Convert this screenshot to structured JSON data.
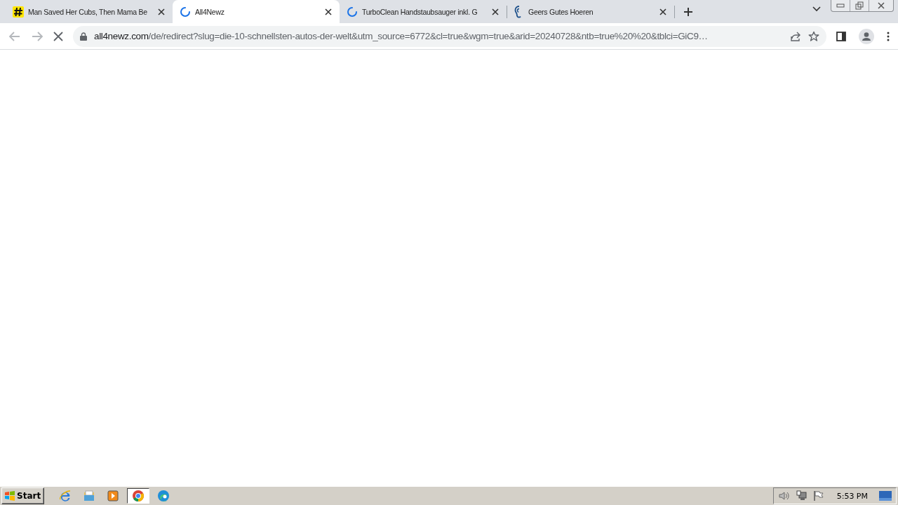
{
  "tabs": [
    {
      "title": "Man Saved Her Cubs, Then Mama Be",
      "kind": "hash",
      "selected": false
    },
    {
      "title": "All4Newz",
      "kind": "loading",
      "selected": true
    },
    {
      "title": "TurboClean Handstaubsauger inkl. G",
      "kind": "loading",
      "selected": false
    },
    {
      "title": "Geers Gutes Hoeren",
      "kind": "ear",
      "selected": false
    }
  ],
  "toolbar": {
    "back_disabled": true,
    "forward_disabled": true,
    "loading": true,
    "address": {
      "host": "all4newz.com",
      "path": "/de/redirect?slug=die-10-schnellsten-autos-der-welt&utm_source=6772&cl=true&wgm=true&arid=20240728&ntb=true%20%20&tblci=GiC9…"
    }
  },
  "taskbar": {
    "start": "Start",
    "apps": [
      {
        "kind": "ie",
        "active": false
      },
      {
        "kind": "explorer",
        "active": false
      },
      {
        "kind": "media",
        "active": false
      },
      {
        "kind": "chrome",
        "active": true
      },
      {
        "kind": "edge",
        "active": false
      }
    ],
    "clock": "5:53 PM"
  }
}
